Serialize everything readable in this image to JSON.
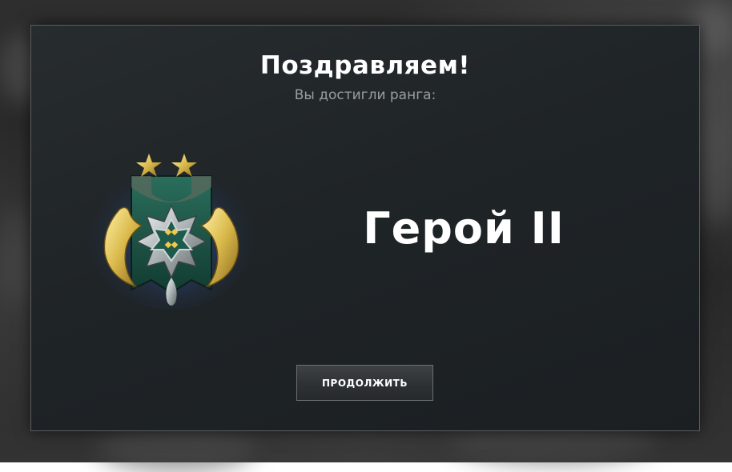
{
  "dialog": {
    "title": "Поздравляем!",
    "subtitle": "Вы достигли ранга:",
    "rank_name": "Герой II",
    "continue_label": "ПРОДОЛЖИТЬ"
  },
  "medal": {
    "icon": "hero-rank-medal-icon",
    "stars": 2
  },
  "colors": {
    "panel": "#1f2427",
    "title": "#ffffff",
    "subtitle": "#9a9ea2",
    "medal_teal": "#1f5b4c",
    "medal_gold": "#d9b84a",
    "medal_glow": "#3a5fa8"
  }
}
